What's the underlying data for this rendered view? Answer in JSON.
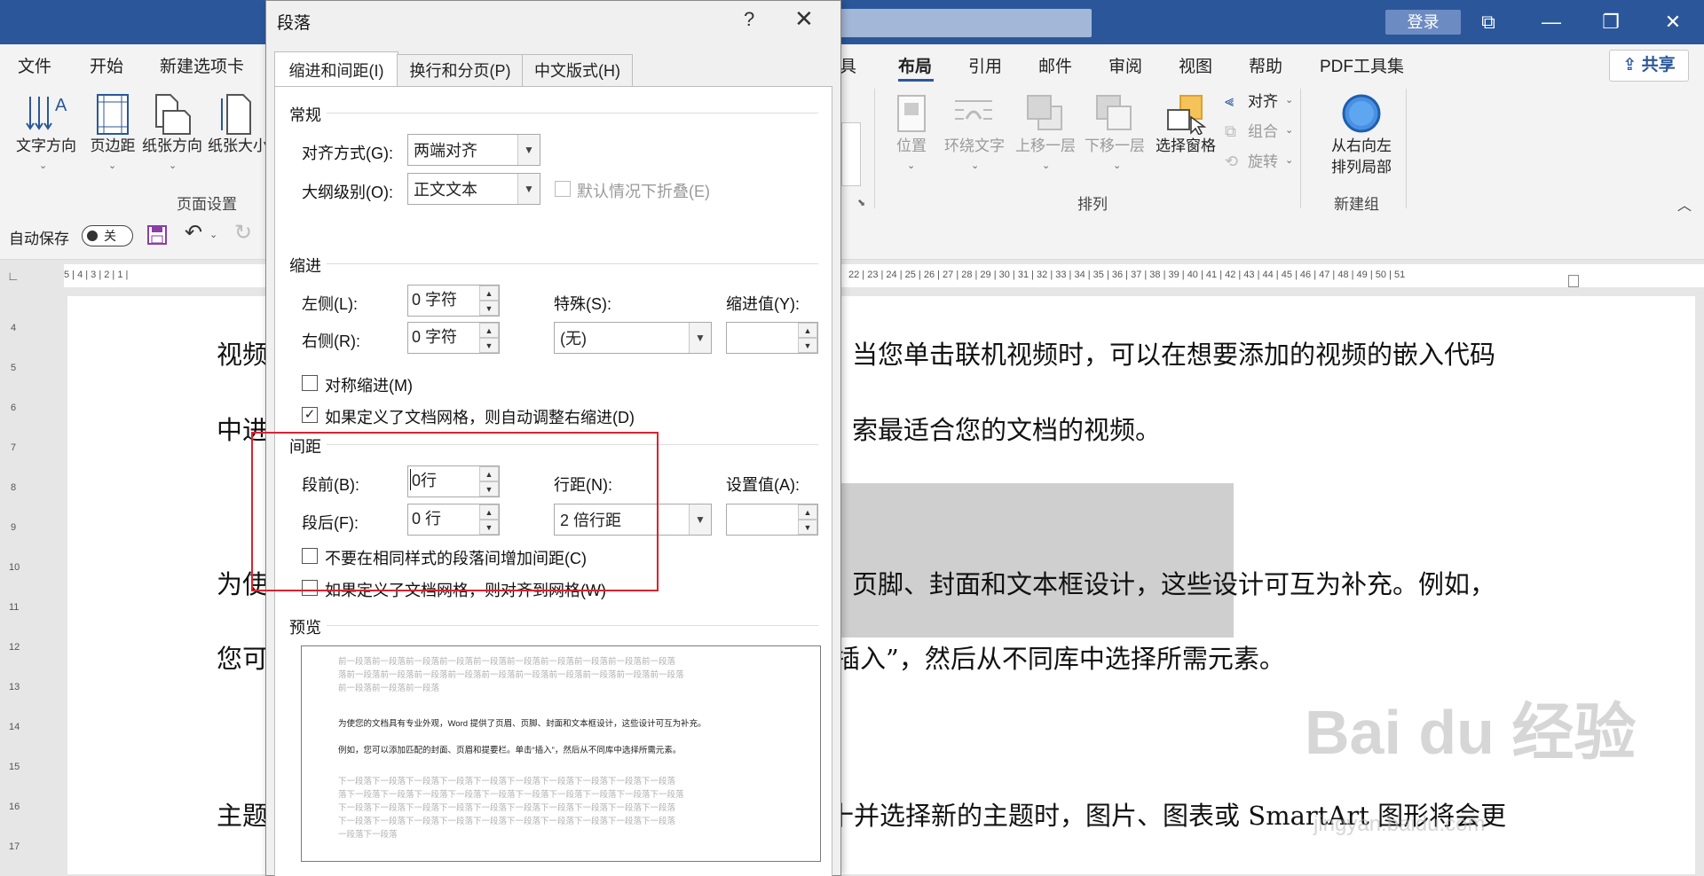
{
  "titlebar": {
    "login": "登录",
    "minimize": "—",
    "restore": "❐",
    "close": "✕",
    "ribbon_display": "⧉"
  },
  "ribbon_tabs": [
    "文件",
    "开始",
    "新建选项卡",
    "具",
    "布局",
    "引用",
    "邮件",
    "审阅",
    "视图",
    "帮助",
    "PDF工具集"
  ],
  "share_label": "共享",
  "ribbon": {
    "page_setup": {
      "items": [
        "文字方向",
        "页边距",
        "纸张方向",
        "纸张大小"
      ],
      "group_label": "页面设置"
    },
    "arrange": {
      "items": [
        "位置",
        "环绕文字",
        "上移一层",
        "下移一层",
        "选择窗格"
      ],
      "align": "对齐",
      "group": "组合",
      "rotate": "旋转",
      "group_label": "排列"
    },
    "new_group": {
      "item_line1": "从右向左",
      "item_line2": "排列局部",
      "group_label": "新建组"
    }
  },
  "qat": {
    "autosave": "自动保存",
    "toggle": "关"
  },
  "ruler_left": "5 | 4 | 3 | 2 | 1 |",
  "ruler_right": "22 | 23 | 24 | 25 | 26 | 27 | 28 | 29 | 30 | 31 | 32 | 33 | 34 | 35 | 36 | 37 | 38 | 39 | 40 | 41 | 42 | 43 | 44 | 45 | 46 | 47 | 48 | 49 | 50 | 51",
  "vruler": [
    "4",
    "5",
    "6",
    "7",
    "8",
    "9",
    "10",
    "11",
    "12",
    "13",
    "14",
    "15",
    "16",
    "17"
  ],
  "document": {
    "lines": [
      {
        "left": "视频",
        "right": "当您单击联机视频时，可以在想要添加的视频的嵌入代码"
      },
      {
        "left": "中进",
        "right": "索最适合您的文档的视频。"
      },
      {
        "left": "为使",
        "right": "页脚、封面和文本框设计，这些设计可互为补充。例如，"
      },
      {
        "left": "您可",
        "right": "插入”，然后从不同库中选择所需元素。"
      },
      {
        "left": "主题",
        "right": "十并选择新的主题时，图片、图表或 SmartArt 图形将会更"
      }
    ]
  },
  "dialog": {
    "title": "段落",
    "help": "?",
    "close": "✕",
    "tabs": [
      "缩进和间距(I)",
      "换行和分页(P)",
      "中文版式(H)"
    ],
    "general": {
      "section": "常规",
      "alignment_label": "对齐方式(G):",
      "alignment_value": "两端对齐",
      "outline_label": "大纲级别(O):",
      "outline_value": "正文文本",
      "collapse_label": "默认情况下折叠(E)"
    },
    "indent": {
      "section": "缩进",
      "left_label": "左侧(L):",
      "left_value": "0 字符",
      "right_label": "右侧(R):",
      "right_value": "0 字符",
      "special_label": "特殊(S):",
      "special_value": "(无)",
      "by_label": "缩进值(Y):",
      "mirror_label": "对称缩进(M)",
      "auto_adjust_label": "如果定义了文档网格，则自动调整右缩进(D)"
    },
    "spacing": {
      "section": "间距",
      "before_label": "段前(B):",
      "before_value": "0行",
      "after_label": "段后(F):",
      "after_value": "0 行",
      "line_label": "行距(N):",
      "line_value": "2 倍行距",
      "at_label": "设置值(A):",
      "no_space_label": "不要在相同样式的段落间增加间距(C)",
      "snap_grid_label": "如果定义了文档网格，则对齐到网格(W)"
    },
    "preview": {
      "section": "预览",
      "prev_lines": [
        "前一段落前一段落前一段落前一段落前一段落前一段落前一段落前一段落前一段落前一段落",
        "落前一段落前一段落前一段落前一段落前一段落前一段落前一段落前一段落前一段落前一段落",
        "前一段落前一段落前一段落"
      ],
      "sample_lines": [
        "为使您的文档具有专业外观，Word 提供了页眉、页脚、封面和文本框设计，这些设计可互为补充。",
        "例如，您可以添加匹配的封面、页眉和提要栏。单击“插入”，然后从不同库中选择所需元素。"
      ],
      "next_lines": [
        "下一段落下一段落下一段落下一段落下一段落下一段落下一段落下一段落下一段落下一段落",
        "落下一段落下一段落下一段落下一段落下一段落下一段落下一段落下一段落下一段落下一段落",
        "下一段落下一段落下一段落下一段落下一段落下一段落下一段落下一段落下一段落下一段落",
        "下一段落下一段落下一段落下一段落下一段落下一段落下一段落下一段落下一段落下一段落",
        "一段落下一段落"
      ]
    }
  },
  "watermark": {
    "main": "Bai du 经验",
    "sub": "jingyan.baidu.com"
  }
}
